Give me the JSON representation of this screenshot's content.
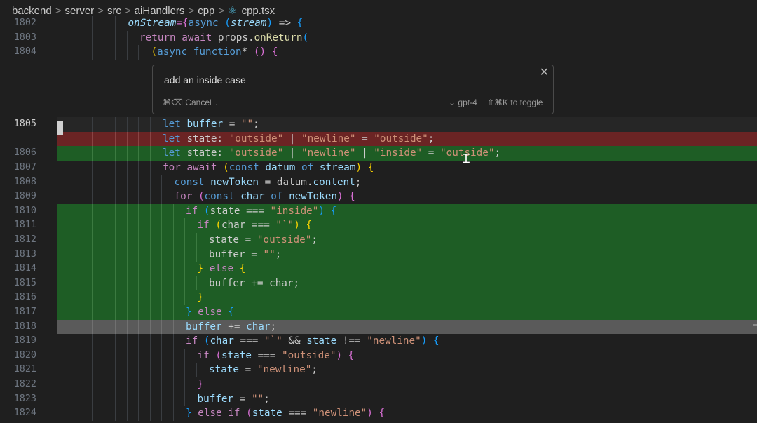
{
  "breadcrumb": {
    "items": [
      "backend",
      "server",
      "src",
      "aiHandlers",
      "cpp"
    ],
    "file": "cpp.tsx",
    "file_icon": "react-icon"
  },
  "prompt": {
    "text": "add an inside case",
    "cancel_label": "⌘⌫ Cancel",
    "dot": ".",
    "model_label": "gpt-4",
    "model_chevron": "⌄",
    "toggle_label": "⇧⌘K to toggle",
    "close": "✕"
  },
  "lines": [
    {
      "num": "1802",
      "indent": 5,
      "tokens": [
        [
          "onStream",
          "var it"
        ],
        [
          "={",
          "p2"
        ],
        [
          "async ",
          "kw"
        ],
        [
          "(",
          "p3"
        ],
        [
          "stream",
          "var it"
        ],
        [
          ")",
          "p3"
        ],
        [
          " => ",
          ""
        ],
        [
          "{",
          "p3"
        ]
      ]
    },
    {
      "num": "1803",
      "indent": 6,
      "tokens": [
        [
          "return ",
          "kw2"
        ],
        [
          "await ",
          "kw2"
        ],
        [
          "props",
          ""
        ],
        [
          ".",
          ""
        ],
        [
          "onReturn",
          "fn"
        ],
        [
          "(",
          "p3"
        ]
      ]
    },
    {
      "num": "1804",
      "indent": 7,
      "tokens": [
        [
          "(",
          "p1"
        ],
        [
          "async ",
          "kw"
        ],
        [
          "function",
          "kw"
        ],
        [
          "* ",
          ""
        ],
        [
          "()",
          "p2"
        ],
        [
          " ",
          ""
        ],
        [
          "{",
          "p2"
        ]
      ]
    },
    {
      "num": "",
      "indent": 0,
      "tokens": []
    },
    {
      "num": "",
      "indent": 0,
      "tokens": []
    },
    {
      "num": "",
      "indent": 0,
      "tokens": []
    },
    {
      "num": "",
      "indent": 0,
      "tokens": []
    },
    {
      "num": "1805",
      "indent": 8,
      "bg": "cur",
      "active": true,
      "tokens": [
        [
          "let ",
          "kw"
        ],
        [
          "buffer",
          "var"
        ],
        [
          " = ",
          ""
        ],
        [
          "\"\"",
          "str"
        ],
        [
          ";",
          ""
        ]
      ]
    },
    {
      "num": "",
      "indent": 8,
      "bg": "removed",
      "tokens": [
        [
          "let ",
          "kw"
        ],
        [
          "state",
          ""
        ],
        [
          ": ",
          ""
        ],
        [
          "\"outside\"",
          "str"
        ],
        [
          " | ",
          ""
        ],
        [
          "\"newline\"",
          "str"
        ],
        [
          " = ",
          ""
        ],
        [
          "\"outside\"",
          "str"
        ],
        [
          ";",
          ""
        ]
      ]
    },
    {
      "num": "1806",
      "indent": 8,
      "bg": "added",
      "tokens": [
        [
          "let ",
          "kw"
        ],
        [
          "state",
          ""
        ],
        [
          ": ",
          ""
        ],
        [
          "\"outside\"",
          "str"
        ],
        [
          " | ",
          ""
        ],
        [
          "\"newline\"",
          "str"
        ],
        [
          " | ",
          ""
        ],
        [
          "\"inside\"",
          "str"
        ],
        [
          " = ",
          ""
        ],
        [
          "\"outside\"",
          "str"
        ],
        [
          ";",
          ""
        ]
      ]
    },
    {
      "num": "1807",
      "indent": 8,
      "tokens": [
        [
          "for ",
          "kw2"
        ],
        [
          "await ",
          "kw2"
        ],
        [
          "(",
          "p1"
        ],
        [
          "const ",
          "kw"
        ],
        [
          "datum ",
          "var"
        ],
        [
          "of ",
          "kw"
        ],
        [
          "stream",
          "var"
        ],
        [
          ") ",
          "p1"
        ],
        [
          "{",
          "p1"
        ]
      ]
    },
    {
      "num": "1808",
      "indent": 9,
      "tokens": [
        [
          "const ",
          "kw"
        ],
        [
          "newToken",
          "var"
        ],
        [
          " = ",
          ""
        ],
        [
          "datum",
          ""
        ],
        [
          ".",
          ""
        ],
        [
          "content",
          "var"
        ],
        [
          ";",
          ""
        ]
      ]
    },
    {
      "num": "1809",
      "indent": 9,
      "tokens": [
        [
          "for ",
          "kw2"
        ],
        [
          "(",
          "p2"
        ],
        [
          "const ",
          "kw"
        ],
        [
          "char ",
          "var"
        ],
        [
          "of ",
          "kw"
        ],
        [
          "newToken",
          "var"
        ],
        [
          ") ",
          "p2"
        ],
        [
          "{",
          "p2"
        ]
      ]
    },
    {
      "num": "1810",
      "indent": 10,
      "bg": "added",
      "tokens": [
        [
          "if ",
          "kw2"
        ],
        [
          "(",
          "p3"
        ],
        [
          "state",
          ""
        ],
        [
          " === ",
          ""
        ],
        [
          "\"inside\"",
          "str"
        ],
        [
          ") ",
          "p3"
        ],
        [
          "{",
          "p3"
        ]
      ]
    },
    {
      "num": "1811",
      "indent": 11,
      "bg": "added",
      "tokens": [
        [
          "if ",
          "kw2"
        ],
        [
          "(",
          "p1"
        ],
        [
          "char",
          ""
        ],
        [
          " === ",
          ""
        ],
        [
          "\"`\"",
          "str"
        ],
        [
          ") ",
          "p1"
        ],
        [
          "{",
          "p1"
        ]
      ]
    },
    {
      "num": "1812",
      "indent": 12,
      "bg": "added",
      "tokens": [
        [
          "state",
          ""
        ],
        [
          " = ",
          ""
        ],
        [
          "\"outside\"",
          "str"
        ],
        [
          ";",
          ""
        ]
      ]
    },
    {
      "num": "1813",
      "indent": 12,
      "bg": "added",
      "tokens": [
        [
          "buffer",
          ""
        ],
        [
          " = ",
          ""
        ],
        [
          "\"\"",
          "str"
        ],
        [
          ";",
          ""
        ]
      ]
    },
    {
      "num": "1814",
      "indent": 11,
      "bg": "added",
      "tokens": [
        [
          "} ",
          "p1"
        ],
        [
          "else ",
          "kw2"
        ],
        [
          "{",
          "p1"
        ]
      ]
    },
    {
      "num": "1815",
      "indent": 12,
      "bg": "added",
      "tokens": [
        [
          "buffer",
          ""
        ],
        [
          " += ",
          ""
        ],
        [
          "char",
          ""
        ],
        [
          ";",
          ""
        ]
      ]
    },
    {
      "num": "1816",
      "indent": 11,
      "bg": "added",
      "tokens": [
        [
          "}",
          "p1"
        ]
      ]
    },
    {
      "num": "1817",
      "indent": 10,
      "bg": "added",
      "tokens": [
        [
          "} ",
          "p3"
        ],
        [
          "else ",
          "kw2"
        ],
        [
          "{",
          "p3"
        ]
      ]
    },
    {
      "num": "1818",
      "indent": 10,
      "bg": "hl",
      "tokens": [
        [
          "buffer",
          "var"
        ],
        [
          " += ",
          ""
        ],
        [
          "char",
          "var"
        ],
        [
          ";",
          ""
        ]
      ]
    },
    {
      "num": "1819",
      "indent": 10,
      "tokens": [
        [
          "if ",
          "kw2"
        ],
        [
          "(",
          "p3"
        ],
        [
          "char",
          "var"
        ],
        [
          " === ",
          ""
        ],
        [
          "\"`\"",
          "str"
        ],
        [
          " && ",
          ""
        ],
        [
          "state",
          "var"
        ],
        [
          " !== ",
          ""
        ],
        [
          "\"newline\"",
          "str"
        ],
        [
          ") ",
          "p3"
        ],
        [
          "{",
          "p3"
        ]
      ]
    },
    {
      "num": "1820",
      "indent": 11,
      "tokens": [
        [
          "if ",
          "kw2"
        ],
        [
          "(",
          "p2"
        ],
        [
          "state",
          "var"
        ],
        [
          " === ",
          ""
        ],
        [
          "\"outside\"",
          "str"
        ],
        [
          ") ",
          "p2"
        ],
        [
          "{",
          "p2"
        ]
      ]
    },
    {
      "num": "1821",
      "indent": 12,
      "tokens": [
        [
          "state",
          "var"
        ],
        [
          " = ",
          ""
        ],
        [
          "\"newline\"",
          "str"
        ],
        [
          ";",
          ""
        ]
      ]
    },
    {
      "num": "1822",
      "indent": 11,
      "tokens": [
        [
          "}",
          "p2"
        ]
      ]
    },
    {
      "num": "1823",
      "indent": 11,
      "tokens": [
        [
          "buffer",
          "var"
        ],
        [
          " = ",
          ""
        ],
        [
          "\"\"",
          "str"
        ],
        [
          ";",
          ""
        ]
      ]
    },
    {
      "num": "1824",
      "indent": 10,
      "tokens": [
        [
          "} ",
          "p3"
        ],
        [
          "else ",
          "kw2"
        ],
        [
          "if ",
          "kw2"
        ],
        [
          "(",
          "p2"
        ],
        [
          "state",
          "var"
        ],
        [
          " === ",
          ""
        ],
        [
          "\"newline\"",
          "str"
        ],
        [
          ") ",
          "p2"
        ],
        [
          "{",
          "p2"
        ]
      ]
    }
  ]
}
